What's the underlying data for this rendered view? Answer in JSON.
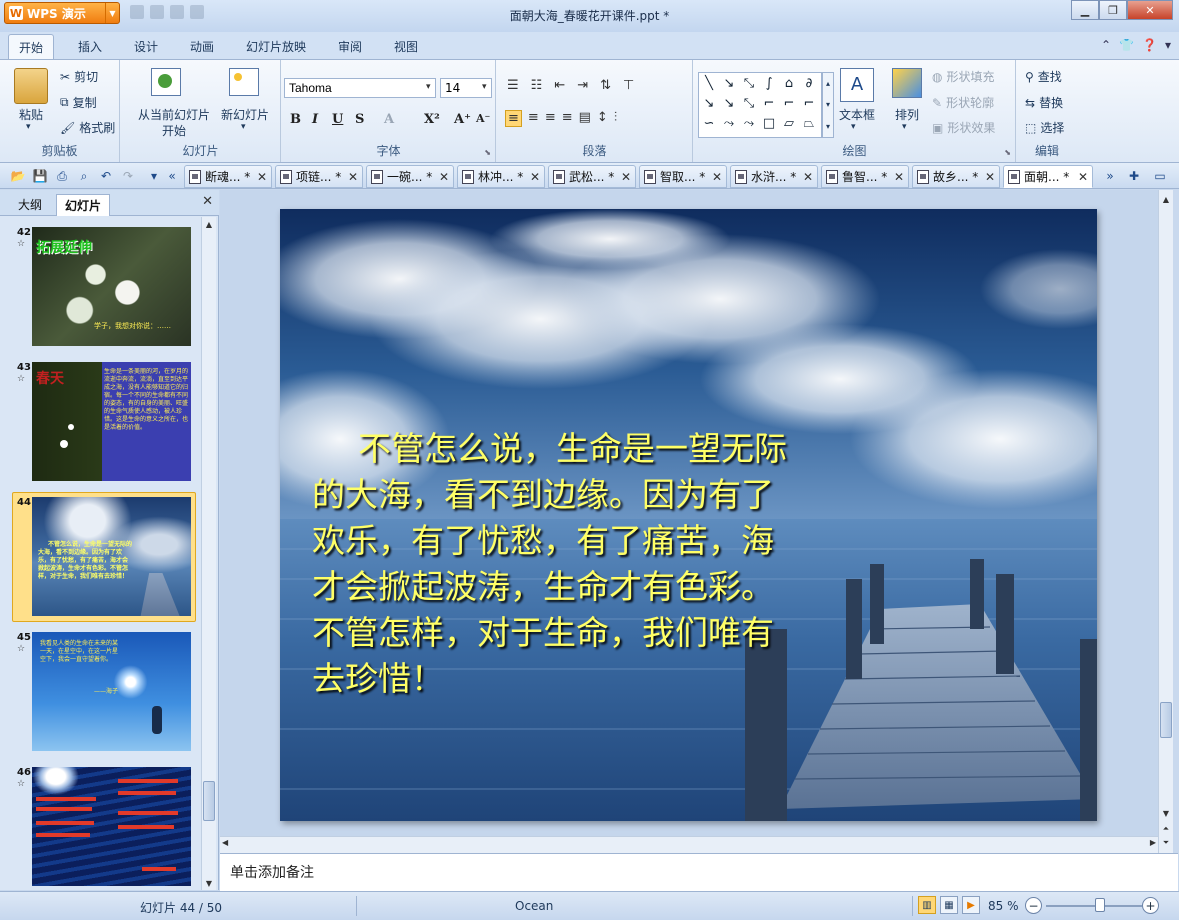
{
  "app": {
    "name": "WPS 演示",
    "window_title": "面朝大海_春暖花开课件.ppt *"
  },
  "menu": {
    "tabs": [
      "开始",
      "插入",
      "设计",
      "动画",
      "幻灯片放映",
      "审阅",
      "视图"
    ],
    "active": "开始"
  },
  "ribbon": {
    "clipboard": {
      "paste": "粘贴",
      "cut": "剪切",
      "copy": "复制",
      "format_painter": "格式刷",
      "label": "剪贴板"
    },
    "slides": {
      "from_current_line1": "从当前幻灯片",
      "from_current_line2": "开始",
      "new_slide": "新幻灯片",
      "label": "幻灯片"
    },
    "font": {
      "name": "Tahoma",
      "size": "14",
      "label": "字体",
      "bold": "B",
      "italic": "I",
      "underline": "U",
      "shadow": "S",
      "color": "A",
      "superscript": "X²",
      "grow": "A⁺",
      "shrink": "A⁻"
    },
    "paragraph": {
      "label": "段落"
    },
    "drawing": {
      "textbox": "文本框",
      "arrange": "排列",
      "shape_fill": "形状填充",
      "shape_outline": "形状轮廓",
      "shape_effect": "形状效果",
      "label": "绘图"
    },
    "editing": {
      "find": "查找",
      "replace": "替换",
      "select": "选择",
      "label": "编辑"
    }
  },
  "doc_tabs": [
    {
      "label": "断魂... *",
      "active": false
    },
    {
      "label": "项链... *",
      "active": false
    },
    {
      "label": "一碗... *",
      "active": false
    },
    {
      "label": "林冲... *",
      "active": false
    },
    {
      "label": "武松... *",
      "active": false
    },
    {
      "label": "智取... *",
      "active": false
    },
    {
      "label": "水浒... *",
      "active": false
    },
    {
      "label": "鲁智... *",
      "active": false
    },
    {
      "label": "故乡... *",
      "active": false
    },
    {
      "label": "面朝... *",
      "active": true
    }
  ],
  "left_panel": {
    "tab_outline": "大纲",
    "tab_slides": "幻灯片",
    "active": "幻灯片"
  },
  "thumbnails": [
    {
      "number": "42",
      "title": "拓展延伸",
      "caption": "学子，我想对你说：……"
    },
    {
      "number": "43",
      "title": "春天",
      "text": "生命是一条美丽的河，在岁月的流逝中奔流，流淌，直至到达平成之海，没有人能够知道它的归宿。每一个不同的生命都有不同的姿态，有的自身的美丽、旺盛的生命气质使人感动，被人珍惜。这是生命的意义之所在，也是活着的价值。"
    },
    {
      "number": "44",
      "text": "不管怎么说，生命是一望无际的大海，看不到边缘。因为有了欢乐，有了忧愁，有了痛苦，海才会掀起波涛，生命才有色彩。不管怎样，对于生命，我们唯有去珍惜！",
      "selected": true
    },
    {
      "number": "45",
      "text": "我看见人类的生命在未来的某一天，在星空中，在这一片星空下，我会一直守望着你。",
      "sign": "——海子"
    },
    {
      "number": "46"
    }
  ],
  "slide": {
    "body": "不管怎么说，生命是一望无际的大海，看不到边缘。因为有了欢乐，有了忧愁，有了痛苦，海才会掀起波涛，生命才有色彩。不管怎样，对于生命，我们唯有去珍惜！"
  },
  "notes": {
    "placeholder": "单击添加备注"
  },
  "status": {
    "slide_info": "幻灯片 44 / 50",
    "theme": "Ocean",
    "zoom": "85 %",
    "zoom_level": 0.56
  },
  "colors": {
    "slide_text": "#ffff66",
    "accent_orange": "#f07d10",
    "ribbon_bg": "#dde8f6"
  }
}
